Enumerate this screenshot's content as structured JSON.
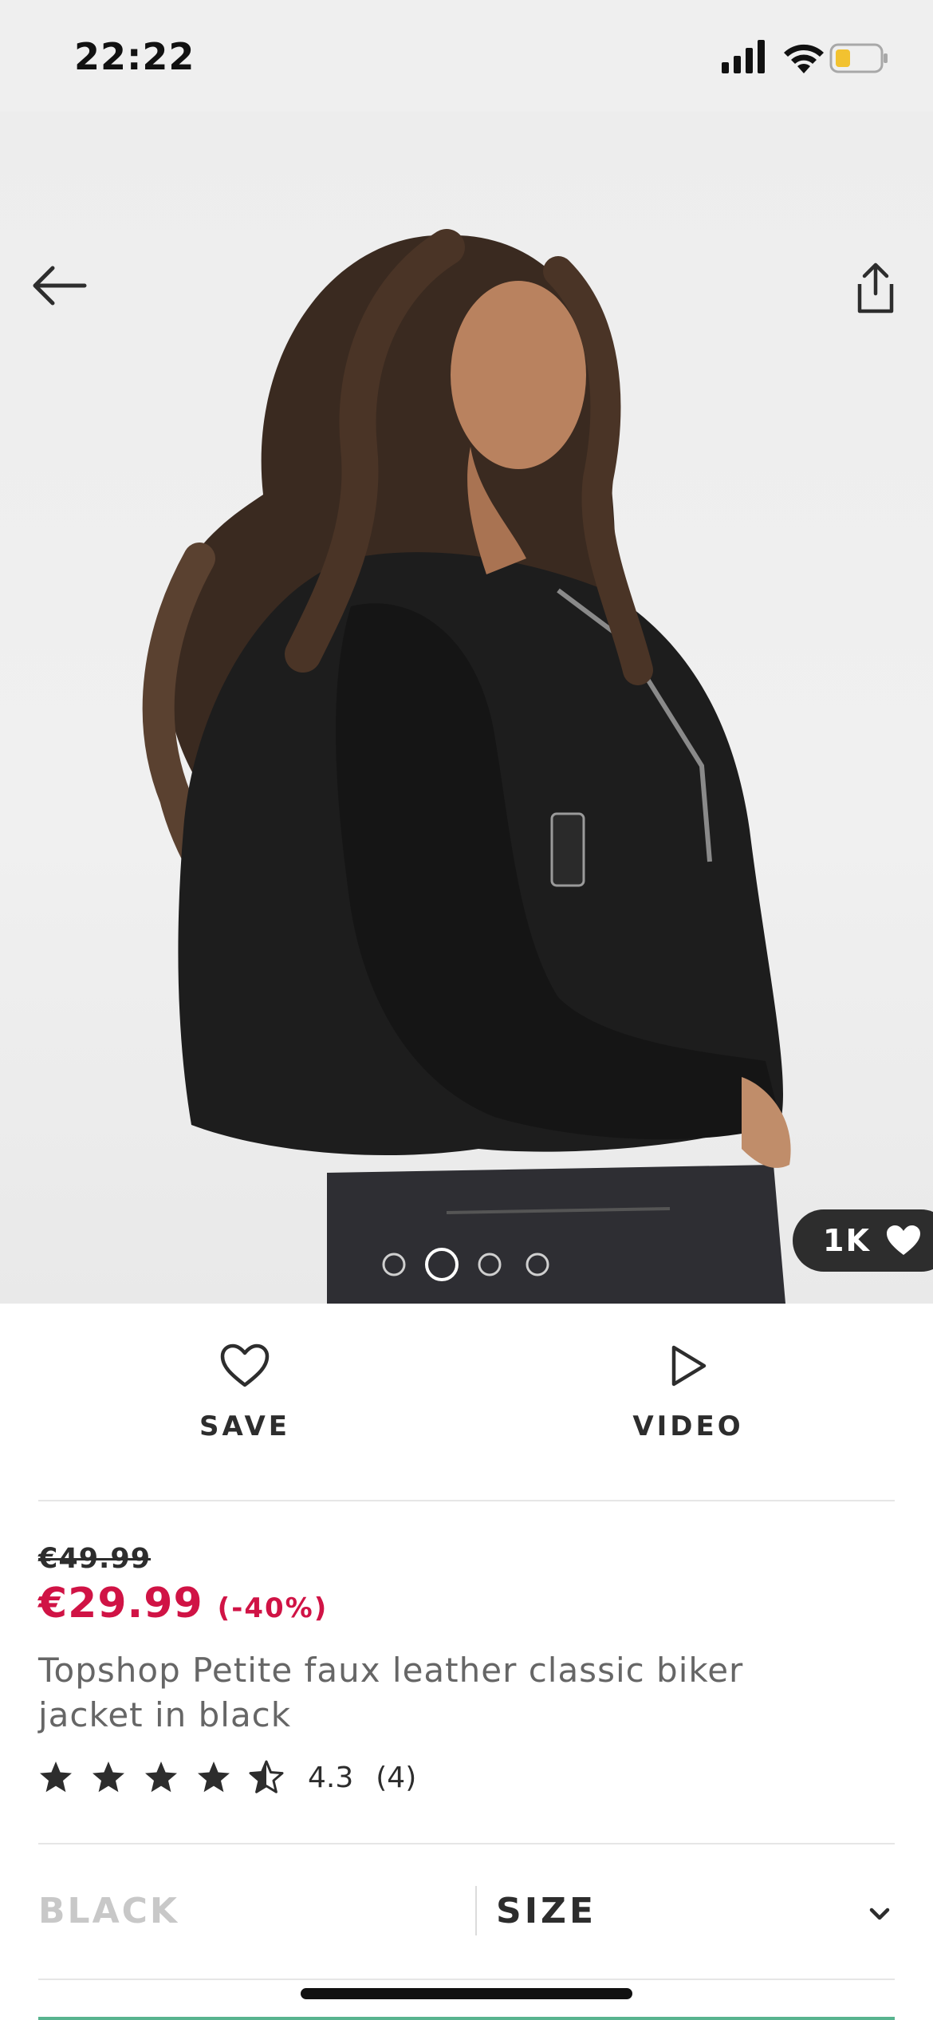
{
  "status_bar": {
    "time": "22:22"
  },
  "product_images": {
    "current_index": 2,
    "count": 4,
    "likes": "1K"
  },
  "actions": {
    "save_label": "SAVE",
    "video_label": "VIDEO"
  },
  "product": {
    "original_price": "€49.99",
    "sale_price": "€29.99",
    "discount": "(-40%)",
    "title": "Topshop Petite faux leather classic biker jacket in black",
    "rating": {
      "value": "4.3",
      "count": "(4)",
      "stars": 4.5
    }
  },
  "selectors": {
    "colour": "BLACK",
    "size": "SIZE"
  },
  "colors": {
    "sale": "#d01345",
    "text": "#2d2d2d",
    "muted": "#c8c8c8"
  },
  "icons": [
    "back-arrow-icon",
    "share-icon",
    "heart-icon",
    "play-icon",
    "star-icon",
    "chevron-down-icon"
  ]
}
